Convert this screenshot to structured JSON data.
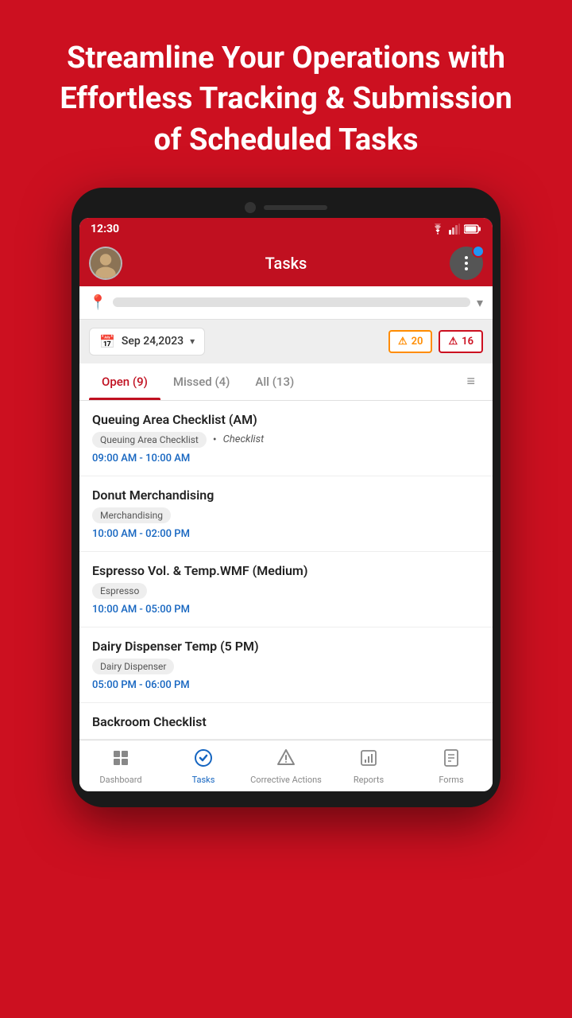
{
  "hero": {
    "headline": "Streamline Your Operations with Effortless Tracking & Submission of Scheduled Tasks"
  },
  "statusBar": {
    "time": "12:30"
  },
  "appBar": {
    "title": "Tasks"
  },
  "locationBar": {
    "placeholder": ""
  },
  "dateFilter": {
    "dateLabel": "Sep 24,2023",
    "alertOrange": "20",
    "alertRed": "16"
  },
  "tabs": [
    {
      "label": "Open (9)",
      "active": true
    },
    {
      "label": "Missed (4)",
      "active": false
    },
    {
      "label": "All (13)",
      "active": false
    }
  ],
  "tasks": [
    {
      "title": "Queuing Area Checklist (AM)",
      "tag": "Queuing Area Checklist",
      "type": "Checklist",
      "time": "09:00 AM - 10:00 AM"
    },
    {
      "title": "Donut Merchandising",
      "tag": "Merchandising",
      "type": "",
      "time": "10:00 AM - 02:00 PM"
    },
    {
      "title": "Espresso Vol. & Temp.WMF (Medium)",
      "tag": "Espresso",
      "type": "",
      "time": "10:00 AM - 05:00 PM"
    },
    {
      "title": "Dairy Dispenser Temp (5 PM)",
      "tag": "Dairy Dispenser",
      "type": "",
      "time": "05:00 PM - 06:00 PM"
    },
    {
      "title": "Backroom Checklist",
      "tag": "",
      "type": "",
      "time": ""
    }
  ],
  "bottomNav": [
    {
      "label": "Dashboard",
      "icon": "⊞",
      "active": false
    },
    {
      "label": "Tasks",
      "icon": "✔",
      "active": true
    },
    {
      "label": "Corrective Actions",
      "icon": "⚠",
      "active": false
    },
    {
      "label": "Reports",
      "icon": "📊",
      "active": false
    },
    {
      "label": "Forms",
      "icon": "📋",
      "active": false
    }
  ]
}
